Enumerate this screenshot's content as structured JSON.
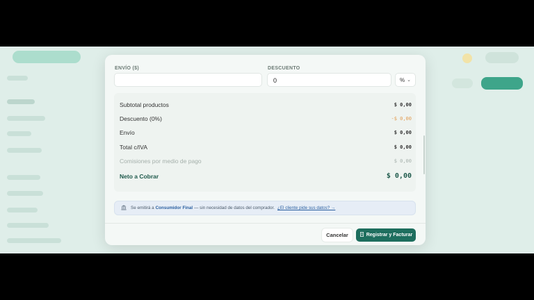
{
  "form": {
    "shipping_label": "ENVÍO ($)",
    "shipping_value": "",
    "discount_label": "DESCUENTO",
    "discount_value": "0",
    "discount_unit": "%"
  },
  "summary": {
    "rows": [
      {
        "label": "Subtotal productos",
        "value": "$ 0,00"
      },
      {
        "label": "Descuento (0%)",
        "value": "-$ 0,00"
      },
      {
        "label": "Envío",
        "value": "$ 0,00"
      },
      {
        "label": "Total c/IVA",
        "value": "$ 0,00"
      },
      {
        "label": "Comisiones por medio de pago",
        "value": "$ 0,00"
      }
    ],
    "net_label": "Neto a Cobrar",
    "net_value": "$ 0,00"
  },
  "info": {
    "prefix": "Se emitirá a",
    "bold": "Consumidor Final",
    "suffix": "— sin necesidad de datos del comprador.",
    "link": "¿El cliente pide sus datos? →"
  },
  "actions": {
    "cancel_label": "Cancelar",
    "submit_label": "Registrar y Facturar"
  },
  "colors": {
    "primary": "#1e6e5e",
    "discount": "#e29b4f",
    "info_link": "#2a5fa0"
  }
}
